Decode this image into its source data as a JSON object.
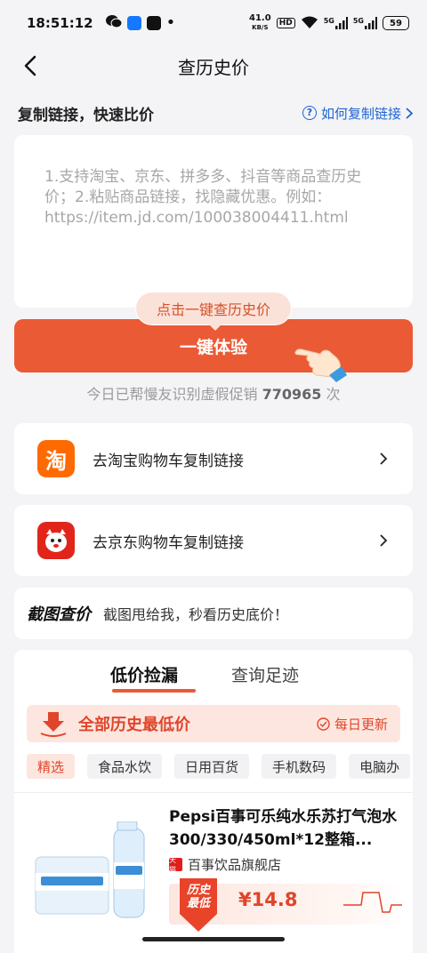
{
  "status": {
    "time": "18:51:12",
    "speed_value": "41.0",
    "speed_unit": "KB/S",
    "hd": "HD",
    "signal1": "5G",
    "signal2": "5G",
    "battery": "59"
  },
  "nav": {
    "title": "查历史价"
  },
  "copy": {
    "title": "复制链接，快速比价",
    "help_link": "如何复制链接"
  },
  "input": {
    "placeholder": "1.支持淘宝、京东、拼多多、抖音等商品查历史价；2.粘贴商品链接，找隐藏优惠。例如：https://item.jd.com/100038004411.html"
  },
  "bubble": "点击一键查历史价",
  "main_button": "一键体验",
  "counter": {
    "prefix": "今日已帮慢友识别虚假促销",
    "count": "770965",
    "suffix": "次"
  },
  "links": {
    "taobao": {
      "logo_char": "淘",
      "label": "去淘宝购物车复制链接"
    },
    "jd": {
      "label": "去京东购物车复制链接"
    }
  },
  "screenshot": {
    "title": "截图查价",
    "desc": "截图甩给我，秒看历史底价！"
  },
  "tabs": {
    "active": "低价捡漏",
    "inactive": "查询足迹"
  },
  "banner": {
    "title": "全部历史最低价",
    "daily": "每日更新"
  },
  "categories": [
    "精选",
    "食品水饮",
    "日用百货",
    "手机数码",
    "电脑办"
  ],
  "product": {
    "name": "Pepsi百事可乐纯水乐苏打气泡水300/330/450ml*12整箱...",
    "shop": "百事饮品旗舰店",
    "tmall_badge": "天猫",
    "badge_line1": "历史",
    "badge_line2": "最低",
    "price": "¥14.8"
  },
  "colors": {
    "accent": "#ea5a35",
    "link": "#1e63d6",
    "background": "#f4f4f6"
  }
}
